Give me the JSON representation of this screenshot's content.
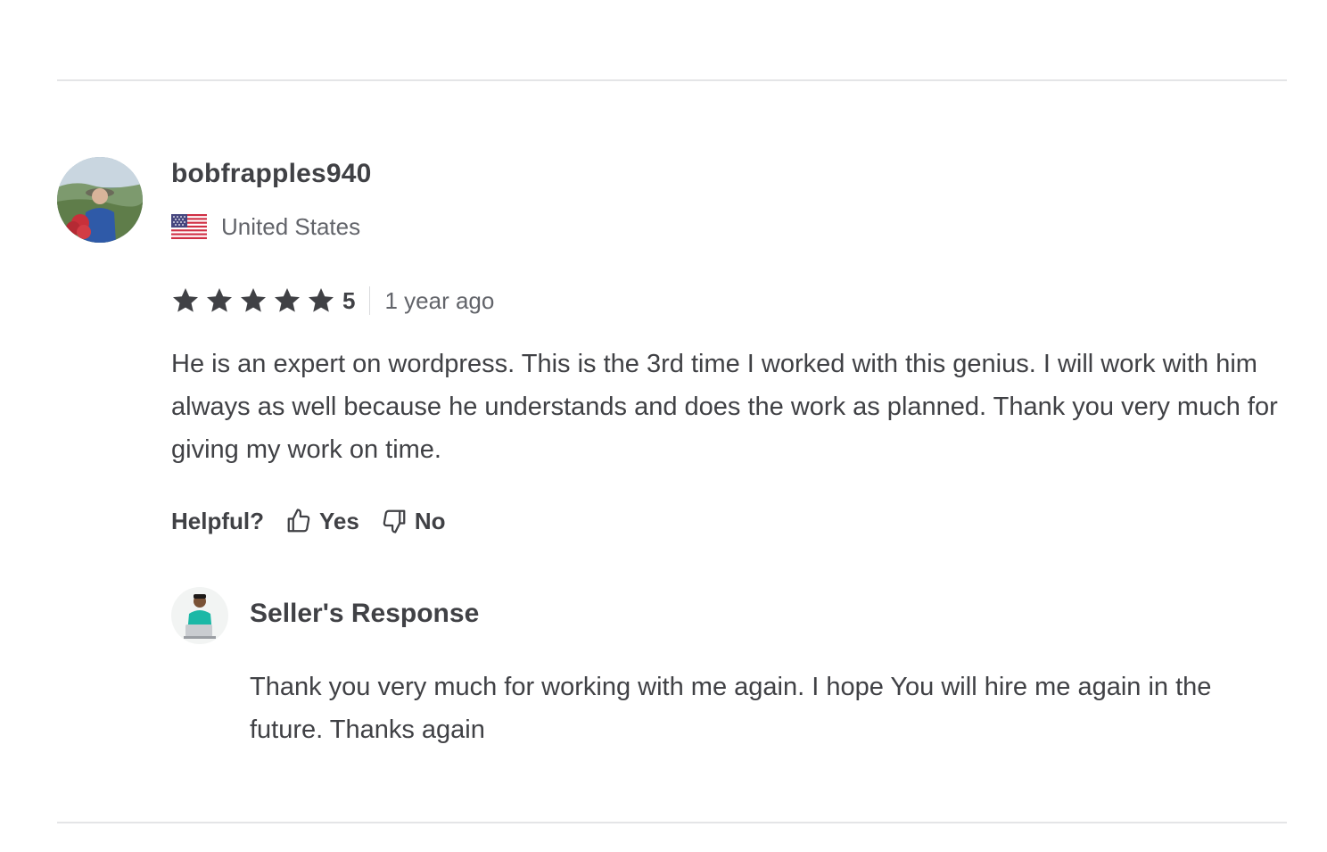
{
  "review": {
    "username": "bobfrapples940",
    "country": "United States",
    "country_flag_icon": "us-flag-icon",
    "rating": "5",
    "time_ago": "1 year ago",
    "text": "He is an expert on wordpress. This is the 3rd time I worked with this genius. I will work with him always as well because he understands and does the work as planned. Thank you very much for giving my work on time.",
    "stars": 5,
    "star_color": "#222325"
  },
  "helpful": {
    "label": "Helpful?",
    "yes_label": "Yes",
    "no_label": "No",
    "yes_icon": "thumbs-up-icon",
    "no_icon": "thumbs-down-icon"
  },
  "seller_response": {
    "title": "Seller's Response",
    "text": "Thank you very much for working with me again. I hope You will hire me again in the future. Thanks again"
  },
  "colors": {
    "text_primary": "#404145",
    "text_secondary": "#62646a",
    "divider": "#e4e5e7"
  }
}
